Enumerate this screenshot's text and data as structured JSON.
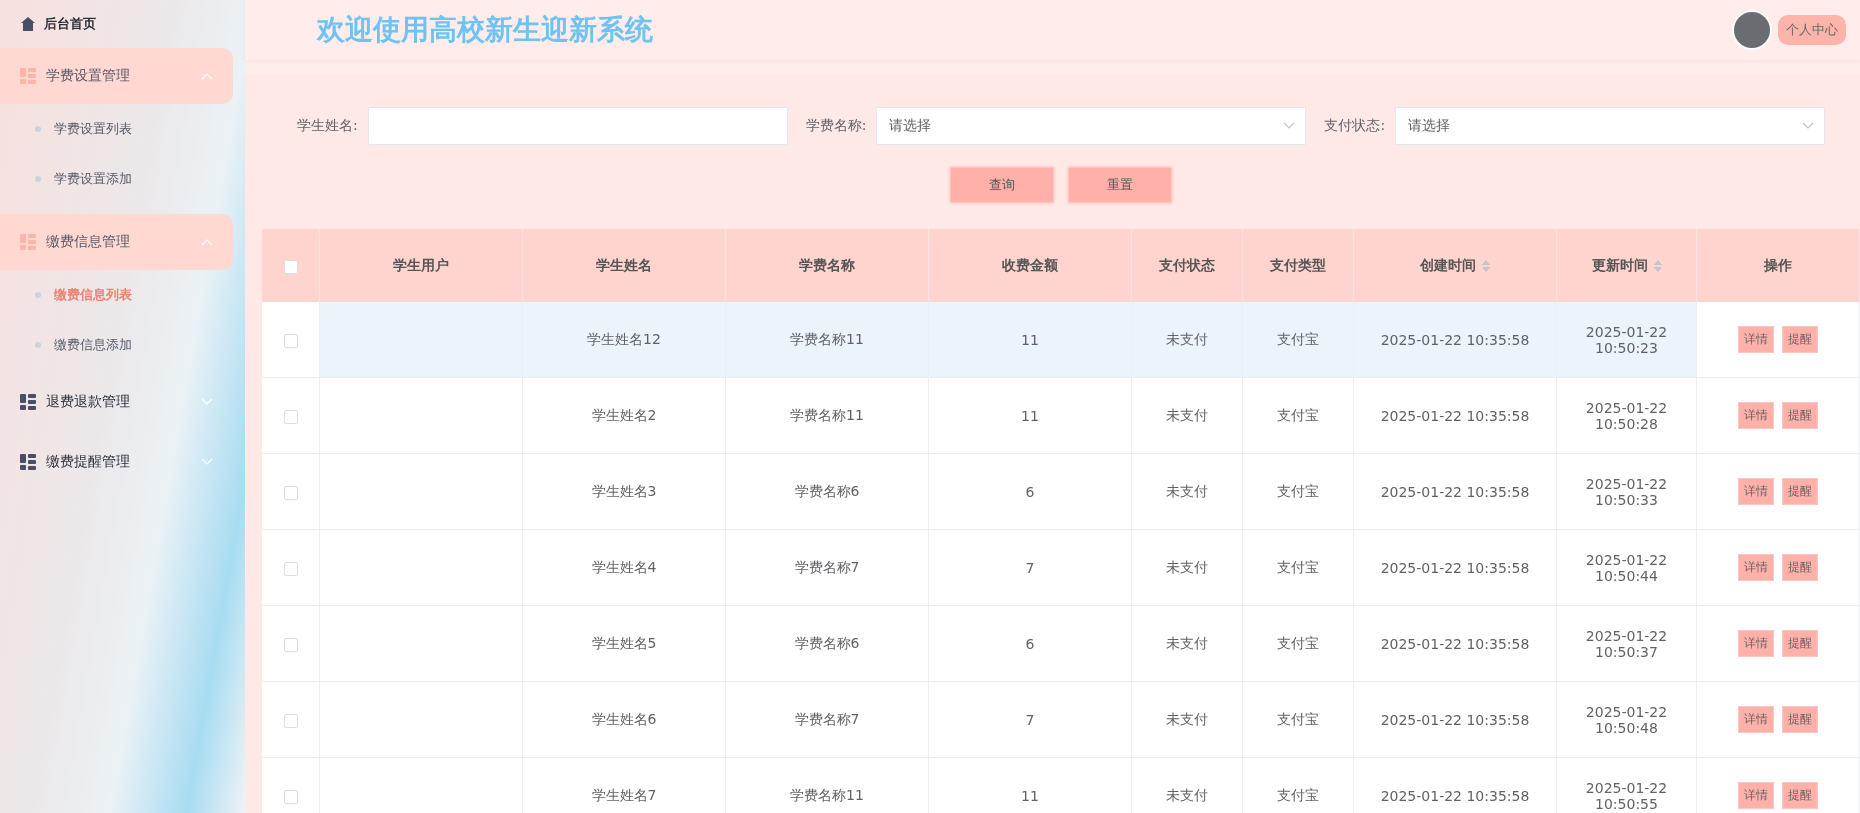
{
  "sidebar": {
    "home": {
      "label": "后台首页"
    },
    "groups": [
      {
        "label": "学费设置管理",
        "expanded": true,
        "children": [
          {
            "label": "学费设置列表",
            "selected": false
          },
          {
            "label": "学费设置添加",
            "selected": false
          }
        ]
      },
      {
        "label": "缴费信息管理",
        "expanded": true,
        "children": [
          {
            "label": "缴费信息列表",
            "selected": true
          },
          {
            "label": "缴费信息添加",
            "selected": false
          }
        ]
      },
      {
        "label": "退费退款管理",
        "expanded": false
      },
      {
        "label": "缴费提醒管理",
        "expanded": false
      }
    ]
  },
  "header": {
    "title": "欢迎使用高校新生迎新系统",
    "user_button": "个人中心"
  },
  "filters": [
    {
      "kind": "text",
      "label": "学生姓名:"
    },
    {
      "kind": "select",
      "label": "学费名称:",
      "placeholder": "请选择"
    },
    {
      "kind": "select",
      "label": "支付状态:",
      "placeholder": "请选择"
    }
  ],
  "filter_buttons": [
    "查询",
    "重置"
  ],
  "table": {
    "all_checked": false,
    "columns": [
      {
        "label": "学生用户",
        "sortable": false
      },
      {
        "label": "学生姓名",
        "sortable": false
      },
      {
        "label": "学费名称",
        "sortable": false
      },
      {
        "label": "收费金额",
        "sortable": false
      },
      {
        "label": "支付状态",
        "sortable": false
      },
      {
        "label": "支付类型",
        "sortable": false
      },
      {
        "label": "创建时间",
        "sortable": true
      },
      {
        "label": "更新时间",
        "sortable": true
      },
      {
        "label": "操作",
        "sortable": false
      }
    ],
    "rows": [
      {
        "checked": false,
        "hovered": true,
        "cells": [
          "",
          "学生姓名12",
          "学费名称11",
          "11",
          "未支付",
          "支付宝",
          "2025-01-22 10:35:58",
          "2025-01-22 10:50:23"
        ],
        "actions": [
          "详情",
          "提醒"
        ]
      },
      {
        "checked": false,
        "hovered": false,
        "cells": [
          "",
          "学生姓名2",
          "学费名称11",
          "11",
          "未支付",
          "支付宝",
          "2025-01-22 10:35:58",
          "2025-01-22 10:50:28"
        ],
        "actions": [
          "详情",
          "提醒"
        ]
      },
      {
        "checked": false,
        "hovered": false,
        "cells": [
          "",
          "学生姓名3",
          "学费名称6",
          "6",
          "未支付",
          "支付宝",
          "2025-01-22 10:35:58",
          "2025-01-22 10:50:33"
        ],
        "actions": [
          "详情",
          "提醒"
        ]
      },
      {
        "checked": false,
        "hovered": false,
        "cells": [
          "",
          "学生姓名4",
          "学费名称7",
          "7",
          "未支付",
          "支付宝",
          "2025-01-22 10:35:58",
          "2025-01-22 10:50:44"
        ],
        "actions": [
          "详情",
          "提醒"
        ]
      },
      {
        "checked": false,
        "hovered": false,
        "cells": [
          "",
          "学生姓名5",
          "学费名称6",
          "6",
          "未支付",
          "支付宝",
          "2025-01-22 10:35:58",
          "2025-01-22 10:50:37"
        ],
        "actions": [
          "详情",
          "提醒"
        ]
      },
      {
        "checked": false,
        "hovered": false,
        "cells": [
          "",
          "学生姓名6",
          "学费名称7",
          "7",
          "未支付",
          "支付宝",
          "2025-01-22 10:35:58",
          "2025-01-22 10:50:48"
        ],
        "actions": [
          "详情",
          "提醒"
        ]
      },
      {
        "checked": false,
        "hovered": false,
        "cells": [
          "",
          "学生姓名7",
          "学费名称11",
          "11",
          "未支付",
          "支付宝",
          "2025-01-22 10:35:58",
          "2025-01-22 10:50:55"
        ],
        "actions": [
          "详情",
          "提醒"
        ]
      }
    ]
  }
}
